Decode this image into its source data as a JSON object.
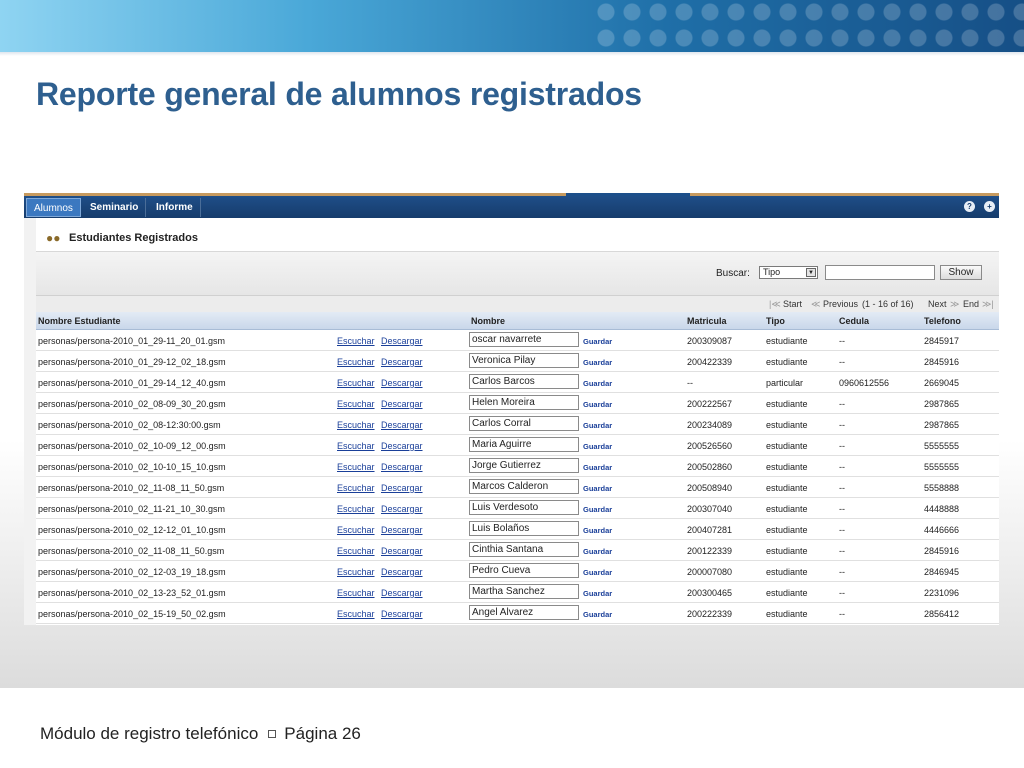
{
  "slide": {
    "title": "Reporte general de alumnos registrados",
    "footer_text": "Módulo de registro telefónico",
    "footer_page": "Página 26"
  },
  "app": {
    "tabs": [
      {
        "label": "Alumnos",
        "active": true
      },
      {
        "label": "Seminario",
        "active": false
      },
      {
        "label": "Informe",
        "active": false
      }
    ],
    "header_icons": [
      "help-icon",
      "add-icon"
    ],
    "page_title": "Estudiantes Registrados",
    "search": {
      "label": "Buscar:",
      "select_value": "Tipo",
      "input_value": "",
      "button_label": "Show"
    },
    "pager": {
      "start": "Start",
      "previous": "Previous",
      "range": "(1 - 16 of 16)",
      "next": "Next",
      "end": "End"
    },
    "columns": [
      "Nombre Estudiante",
      "Nombre",
      "Matricula",
      "Tipo",
      "Cedula",
      "Telefono"
    ],
    "link_escuchar": "Escuchar",
    "link_descargar": "Descargar",
    "link_guardar": "Guardar",
    "rows": [
      {
        "file": "personas/persona-2010_01_29-11_20_01.gsm",
        "nombre": "oscar navarrete",
        "matricula": "200309087",
        "tipo": "estudiante",
        "cedula": "--",
        "telefono": "2845917"
      },
      {
        "file": "personas/persona-2010_01_29-12_02_18.gsm",
        "nombre": "Veronica Pilay",
        "matricula": "200422339",
        "tipo": "estudiante",
        "cedula": "--",
        "telefono": "2845916"
      },
      {
        "file": "personas/persona-2010_01_29-14_12_40.gsm",
        "nombre": "Carlos Barcos",
        "matricula": "--",
        "tipo": "particular",
        "cedula": "0960612556",
        "telefono": "2669045"
      },
      {
        "file": "personas/persona-2010_02_08-09_30_20.gsm",
        "nombre": "Helen Moreira",
        "matricula": "200222567",
        "tipo": "estudiante",
        "cedula": "--",
        "telefono": "2987865"
      },
      {
        "file": "personas/persona-2010_02_08-12:30:00.gsm",
        "nombre": "Carlos Corral",
        "matricula": "200234089",
        "tipo": "estudiante",
        "cedula": "--",
        "telefono": "2987865"
      },
      {
        "file": "personas/persona-2010_02_10-09_12_00.gsm",
        "nombre": "Maria Aguirre",
        "matricula": "200526560",
        "tipo": "estudiante",
        "cedula": "--",
        "telefono": "5555555"
      },
      {
        "file": "personas/persona-2010_02_10-10_15_10.gsm",
        "nombre": "Jorge Gutierrez",
        "matricula": "200502860",
        "tipo": "estudiante",
        "cedula": "--",
        "telefono": "5555555"
      },
      {
        "file": "personas/persona-2010_02_11-08_11_50.gsm",
        "nombre": "Marcos Calderon",
        "matricula": "200508940",
        "tipo": "estudiante",
        "cedula": "--",
        "telefono": "5558888"
      },
      {
        "file": "personas/persona-2010_02_11-21_10_30.gsm",
        "nombre": "Luis Verdesoto",
        "matricula": "200307040",
        "tipo": "estudiante",
        "cedula": "--",
        "telefono": "4448888"
      },
      {
        "file": "personas/persona-2010_02_12-12_01_10.gsm",
        "nombre": "Luis Bolaños",
        "matricula": "200407281",
        "tipo": "estudiante",
        "cedula": "--",
        "telefono": "4446666"
      },
      {
        "file": "personas/persona-2010_02_11-08_11_50.gsm",
        "nombre": "Cinthia Santana",
        "matricula": "200122339",
        "tipo": "estudiante",
        "cedula": "--",
        "telefono": "2845916"
      },
      {
        "file": "personas/persona-2010_02_12-03_19_18.gsm",
        "nombre": "Pedro Cueva",
        "matricula": "200007080",
        "tipo": "estudiante",
        "cedula": "--",
        "telefono": "2846945"
      },
      {
        "file": "personas/persona-2010_02_13-23_52_01.gsm",
        "nombre": "Martha Sanchez",
        "matricula": "200300465",
        "tipo": "estudiante",
        "cedula": "--",
        "telefono": "2231096"
      },
      {
        "file": "personas/persona-2010_02_15-19_50_02.gsm",
        "nombre": "Angel Alvarez",
        "matricula": "200222339",
        "tipo": "estudiante",
        "cedula": "--",
        "telefono": "2856412"
      }
    ]
  },
  "colors": {
    "title": "#2e5f8f",
    "navbar": "#163c6c",
    "active_tab": "#3b78c0",
    "link": "#1a3f99"
  }
}
